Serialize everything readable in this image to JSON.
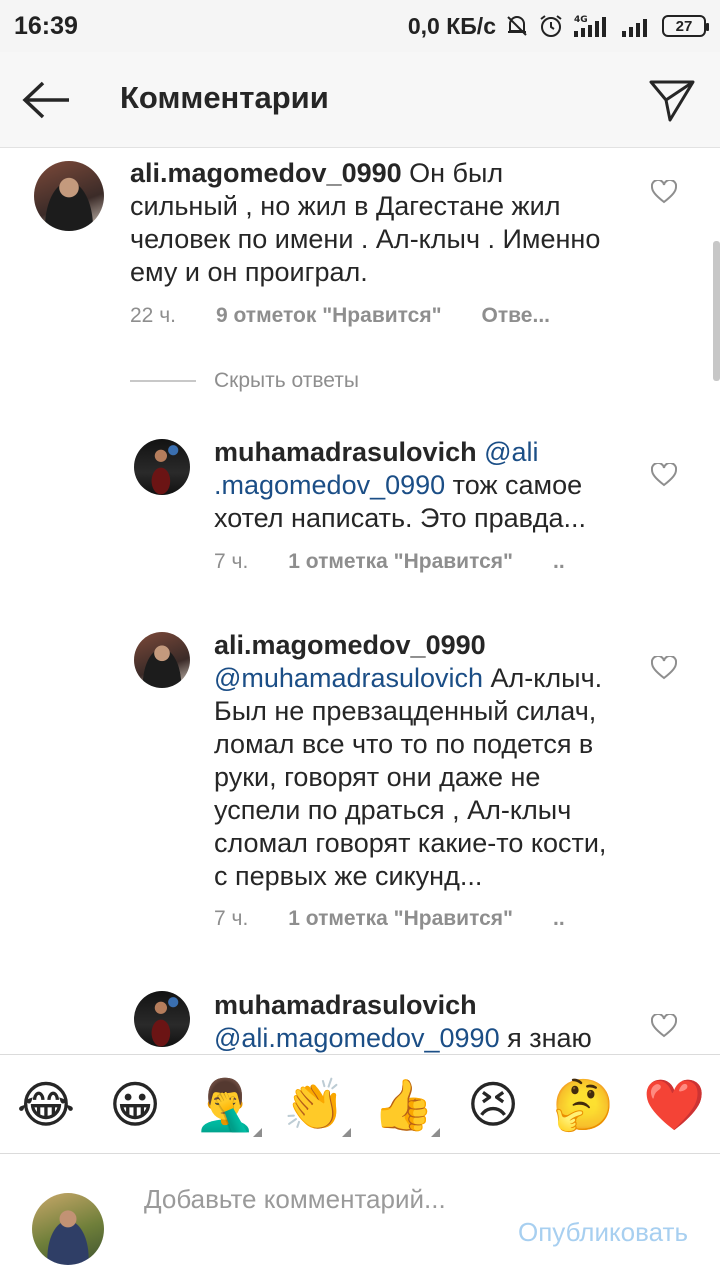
{
  "status_bar": {
    "time": "16:39",
    "speed": "0,0 КБ/с",
    "network": "4G",
    "battery": "27"
  },
  "header": {
    "title": "Комментарии",
    "back_icon": "arrow-left-icon",
    "send_icon": "paper-plane-icon"
  },
  "comments": [
    {
      "username": "ali.magomedov_0990",
      "mention": "",
      "text": " Он был сильный , но жил в Дагестане жил человек по имени . Ал-клыч . Именно ему и он проиграл.",
      "time": "22 ч.",
      "likes": "9 отметок \"Нравится\"",
      "reply": "Отве..."
    },
    {
      "username": "muhamadrasulovich",
      "mention": "@ali .magomedov_0990",
      "text": " тож самое хотел написать. Это правда...",
      "time": "7 ч.",
      "likes": "1 отметка \"Нравится\"",
      "reply": ".."
    },
    {
      "username": "ali.magomedov_0990",
      "mention": "@muhamadrasulovich",
      "text": " Ал-клыч. Был не превзацденный силач, ломал все что то по подется в руки, говорят они даже не успели по драться , Ал-клыч сломал говорят какие-то кости, с первых же сикунд...",
      "time": "7 ч.",
      "likes": "1 отметка \"Нравится\"",
      "reply": ".."
    },
    {
      "username": "muhamadrasulovich",
      "mention": "@ali.magomedov_0990",
      "text": " я знаю",
      "time": "",
      "likes": "",
      "reply": ""
    }
  ],
  "hide_replies": "Скрыть ответы",
  "emojis": [
    "😂",
    "😀",
    "🤦‍♂️",
    "👏",
    "👍",
    "😣",
    "🤔",
    "❤️"
  ],
  "input": {
    "placeholder": "Добавьте комментарий...",
    "publish": "Опубликовать"
  },
  "colors": {
    "mention": "#1b4e86",
    "meta": "#8e8e8e",
    "publish_disabled": "#a7cff0"
  }
}
